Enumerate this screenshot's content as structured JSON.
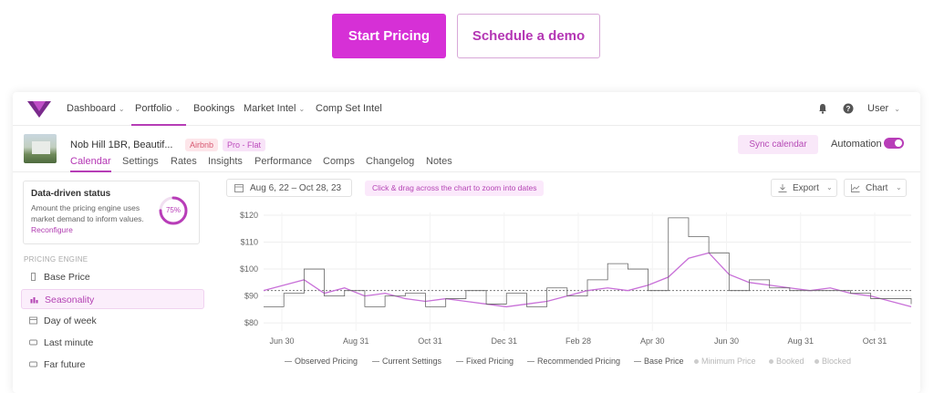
{
  "cta": {
    "primary_label": "Start Pricing",
    "secondary_label": "Schedule a demo"
  },
  "colors": {
    "accent": "#d630d6",
    "nav_accent": "#b63db6",
    "line_observed": "#c870d8",
    "line_base": "#555555"
  },
  "topnav": {
    "items": [
      {
        "label": "Dashboard",
        "dropdown": true
      },
      {
        "label": "Portfolio",
        "dropdown": true,
        "active": true
      },
      {
        "label": "Bookings",
        "dropdown": false
      },
      {
        "label": "Market Intel",
        "dropdown": true
      },
      {
        "label": "Comp Set Intel",
        "dropdown": false
      }
    ],
    "user_label": "User"
  },
  "listing": {
    "title": "Nob Hill 1BR, Beautif...",
    "channel_badge": "Airbnb",
    "plan_badge": "Pro - Flat",
    "tabs": [
      "Calendar",
      "Settings",
      "Rates",
      "Insights",
      "Performance",
      "Comps",
      "Changelog",
      "Notes"
    ],
    "active_tab": "Calendar",
    "sync_label": "Sync calendar",
    "automation_label": "Automation",
    "automation_on": true
  },
  "status_card": {
    "title": "Data-driven status",
    "description": "Amount the pricing engine uses market demand to inform values.",
    "link": "Reconfigure",
    "progress_percent": 75,
    "progress_label": "75%"
  },
  "sidebar": {
    "heading": "PRICING ENGINE",
    "items": [
      {
        "label": "Base Price",
        "icon": "bar-icon"
      },
      {
        "label": "Seasonality",
        "icon": "chart-icon",
        "active": true
      },
      {
        "label": "Day of week",
        "icon": "calendar-week-icon"
      },
      {
        "label": "Last minute",
        "icon": "clock-icon"
      },
      {
        "label": "Far future",
        "icon": "calendar-future-icon"
      }
    ]
  },
  "toolbar": {
    "date_range": "Aug 6, 22 – Oct 28, 23",
    "hint": "Click & drag across the chart to zoom into dates",
    "export_label": "Export",
    "chart_label": "Chart"
  },
  "chart_data": {
    "type": "line",
    "title": "",
    "xlabel": "",
    "ylabel": "",
    "x_tick_labels": [
      "Jun 30",
      "Aug 31",
      "Oct 31",
      "Dec 31",
      "Feb 28",
      "Apr 30",
      "Jun 30",
      "Aug 31",
      "Oct 31"
    ],
    "y_tick_labels": [
      "$120",
      "$110",
      "$100",
      "$90",
      "$80"
    ],
    "y_ticks": [
      120,
      110,
      100,
      90,
      80
    ],
    "ylim": [
      77,
      121
    ],
    "grid": true,
    "reference_line": 92,
    "x": [
      0,
      0.5,
      1,
      1.5,
      2,
      2.5,
      3,
      3.5,
      4,
      4.5,
      5,
      5.5,
      6,
      6.5,
      7,
      7.5,
      8,
      8.5,
      9,
      9.5,
      10,
      10.5,
      11,
      11.5,
      12,
      12.5,
      13,
      13.5,
      14,
      14.5,
      15,
      15.5,
      16
    ],
    "series": [
      {
        "name": "Observed Pricing",
        "style": "solid",
        "values": [
          92,
          94,
          96,
          91,
          93,
          90,
          91,
          89,
          88,
          89,
          88,
          87,
          86,
          87,
          88,
          90,
          92,
          93,
          92,
          94,
          97,
          104,
          106,
          98,
          95,
          94,
          93,
          92,
          93,
          91,
          90,
          88,
          86
        ]
      },
      {
        "name": "Base Price",
        "style": "step",
        "values": [
          86,
          91,
          100,
          90,
          92,
          86,
          90,
          91,
          86,
          89,
          92,
          87,
          91,
          86,
          93,
          90,
          96,
          102,
          100,
          92,
          119,
          112,
          106,
          92,
          96,
          93,
          92,
          92,
          92,
          91,
          89,
          89,
          87
        ]
      }
    ],
    "legend": {
      "placement": "bottom",
      "entries": [
        {
          "label": "Observed Pricing",
          "enabled": true
        },
        {
          "label": "Current Settings",
          "enabled": true
        },
        {
          "label": "Fixed Pricing",
          "enabled": true
        },
        {
          "label": "Recommended Pricing",
          "enabled": true
        },
        {
          "label": "Base Price",
          "enabled": true
        },
        {
          "label": "Minimum Price",
          "enabled": false
        },
        {
          "label": "Booked",
          "enabled": false
        },
        {
          "label": "Blocked",
          "enabled": false
        }
      ]
    }
  }
}
